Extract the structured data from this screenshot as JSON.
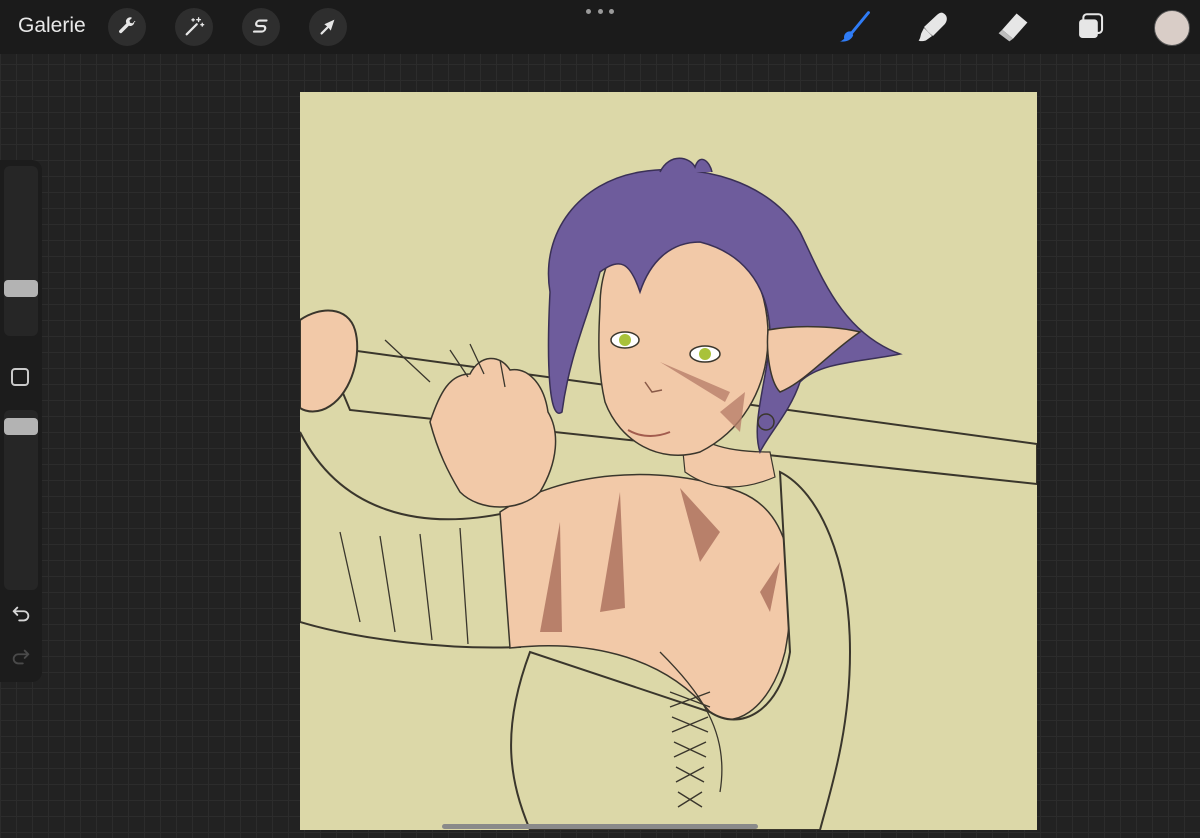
{
  "topbar": {
    "gallery_label": "Galerie",
    "left_tools": [
      {
        "icon": "wrench-icon",
        "name": "actions"
      },
      {
        "icon": "magic-wand-icon",
        "name": "adjustments"
      },
      {
        "icon": "selection-s-icon",
        "name": "selection"
      },
      {
        "icon": "arrow-cursor-icon",
        "name": "transform"
      }
    ],
    "right_tools": [
      {
        "icon": "brush-icon",
        "name": "paint",
        "active": true
      },
      {
        "icon": "smudge-icon",
        "name": "smudge",
        "active": false
      },
      {
        "icon": "eraser-icon",
        "name": "eraser",
        "active": false
      },
      {
        "icon": "layers-icon",
        "name": "layers",
        "active": false
      }
    ],
    "current_color": "#d9cdc7"
  },
  "sidebar": {
    "brush_size_level": 0.72,
    "opacity_level": 1.0,
    "undo_icon": "undo-icon",
    "redo_icon": "redo-icon"
  },
  "colors": {
    "accent": "#2f7cf6",
    "canvas_bg": "#dcd8a8",
    "hair": "#6e5c9c",
    "skin": "#f2c9a8"
  }
}
